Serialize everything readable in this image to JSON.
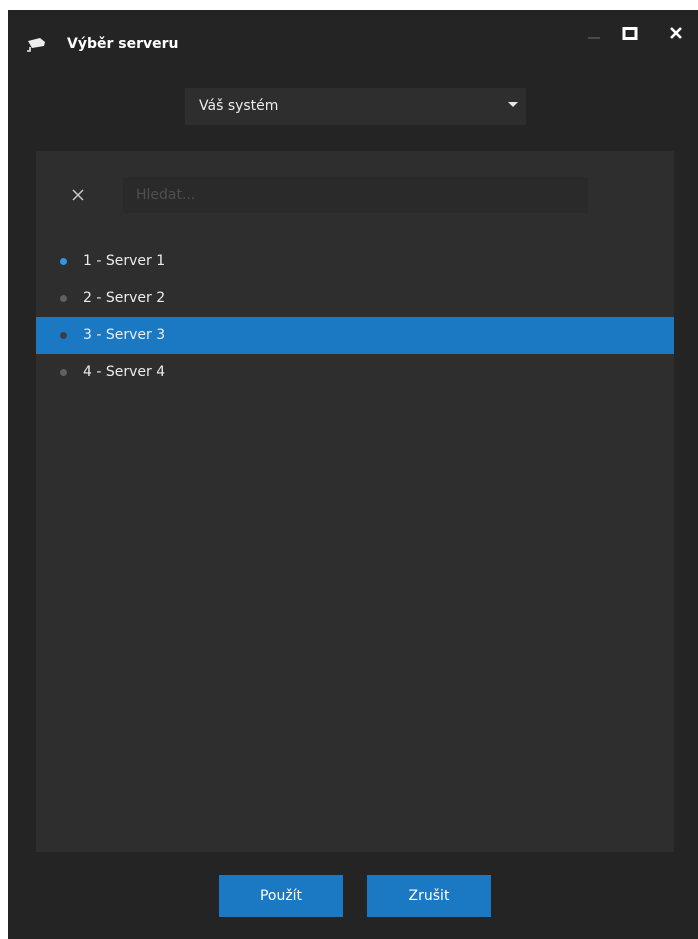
{
  "window": {
    "title": "Výběr serveru",
    "app_icon": "camera-icon",
    "controls": [
      "minimize-icon",
      "maximize-icon",
      "close-icon"
    ]
  },
  "system_select": {
    "value": "Váš systém"
  },
  "search": {
    "placeholder": "Hledat...",
    "value": "",
    "clear_icon": "close-icon"
  },
  "servers": [
    {
      "label": "1 - Server 1",
      "status": "online",
      "selected": false
    },
    {
      "label": "2 - Server 2",
      "status": "offline",
      "selected": false
    },
    {
      "label": "3 - Server 3",
      "status": "offline",
      "selected": true
    },
    {
      "label": "4 - Server 4",
      "status": "offline",
      "selected": false
    }
  ],
  "buttons": {
    "apply": "Použít",
    "cancel": "Zrušit"
  },
  "colors": {
    "accent": "#1b79c4",
    "status_online": "#2f97ea",
    "status_offline": "#606060",
    "status_offline_selected": "#3b3d40"
  }
}
